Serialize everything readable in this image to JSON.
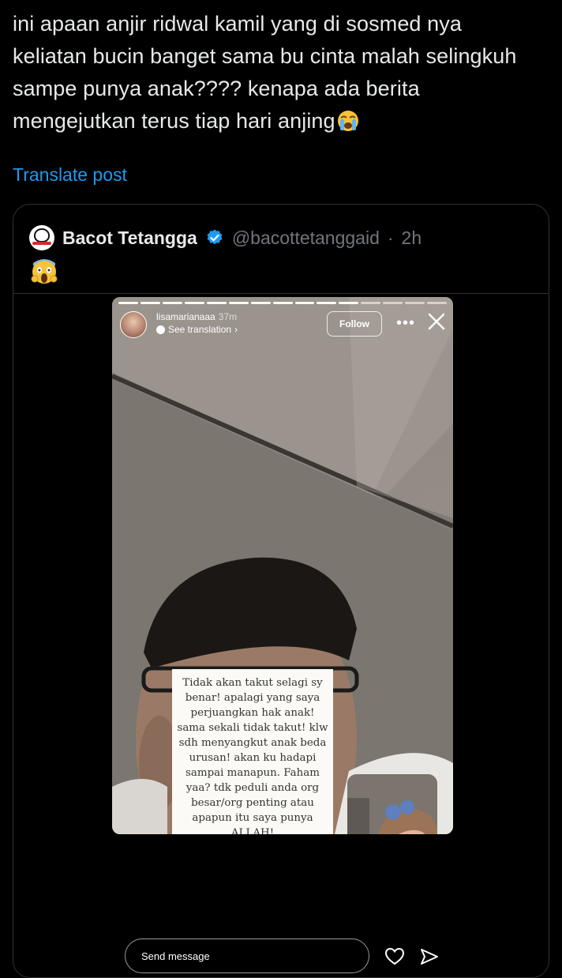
{
  "tweet": {
    "text": "ini apaan anjir ridwal kamil yang di sosmed nya keliatan bucin banget sama bu cinta malah selingkuh sampe punya anak???? kenapa ada berita mengejutkan terus tiap hari anjing",
    "emoji": "loudly-crying-face",
    "translate_label": "Translate post"
  },
  "quote": {
    "name": "Bacot Tetangga",
    "handle": "@bacottetanggaid",
    "separator": "·",
    "time": "2h",
    "emoji": "face-screaming-in-fear",
    "verified_color": "#1d9bf0"
  },
  "story": {
    "username": "lisamarianaaa",
    "time": "37m",
    "see_translation": "See translation",
    "follow_label": "Follow",
    "overlay_text": "Tidak akan takut selagi sy benar! apalagi yang saya perjuangkan hak anak! sama sekali tidak takut! klw sdh menyangkut anak beda urusan! akan ku hadapi sampai manapun. Faham yaa? tdk peduli anda org besar/org penting atau apapun itu saya punya ALLAH!",
    "send_placeholder": "Send message"
  },
  "colors": {
    "background": "#000000",
    "text": "#e7e9ea",
    "link": "#1d9bf0",
    "muted": "#71767b",
    "border": "#2f3336"
  }
}
